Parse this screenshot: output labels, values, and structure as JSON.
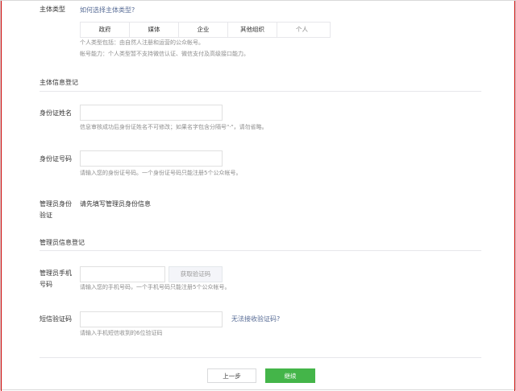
{
  "subject_type": {
    "label": "主体类型",
    "help_link": "如何选择主体类型?",
    "options": [
      "政府",
      "媒体",
      "企业",
      "其他组织",
      "个人"
    ],
    "selected": "个人",
    "note1": "个人类型包括：由自然人注册和运营的公众帐号。",
    "note2": "帐号能力：个人类型暂不支持微信认证、微信支付及高级接口能力。"
  },
  "subject_info": {
    "section_title": "主体信息登记",
    "id_name": {
      "label": "身份证姓名",
      "value": "",
      "tip": "信息审核成功后身份证姓名不可修改；如果名字包含分隔号\"·\"，请勿省略。"
    },
    "id_number": {
      "label": "身份证号码",
      "value": "",
      "tip": "请输入您的身份证号码。一个身份证号码只能注册5个公众帐号。"
    },
    "admin_verify": {
      "label_line1": "管理员身份",
      "label_line2": "验证",
      "text": "请先填写管理员身份信息"
    }
  },
  "admin_info": {
    "section_title": "管理员信息登记",
    "phone": {
      "label_line1": "管理员手机",
      "label_line2": "号码",
      "value": "",
      "get_code_button": "获取验证码",
      "tip": "请输入您的手机号码，一个手机号码只能注册5个公众帐号。"
    },
    "sms_code": {
      "label": "短信验证码",
      "value": "",
      "help_link": "无法接收验证码?",
      "tip": "请输入手机短信收到的6位验证码"
    }
  },
  "footer": {
    "prev_button": "上一步",
    "next_button": "继续"
  },
  "colors": {
    "primary": "#44b549",
    "link": "#576b95",
    "border": "#e7e7eb"
  }
}
